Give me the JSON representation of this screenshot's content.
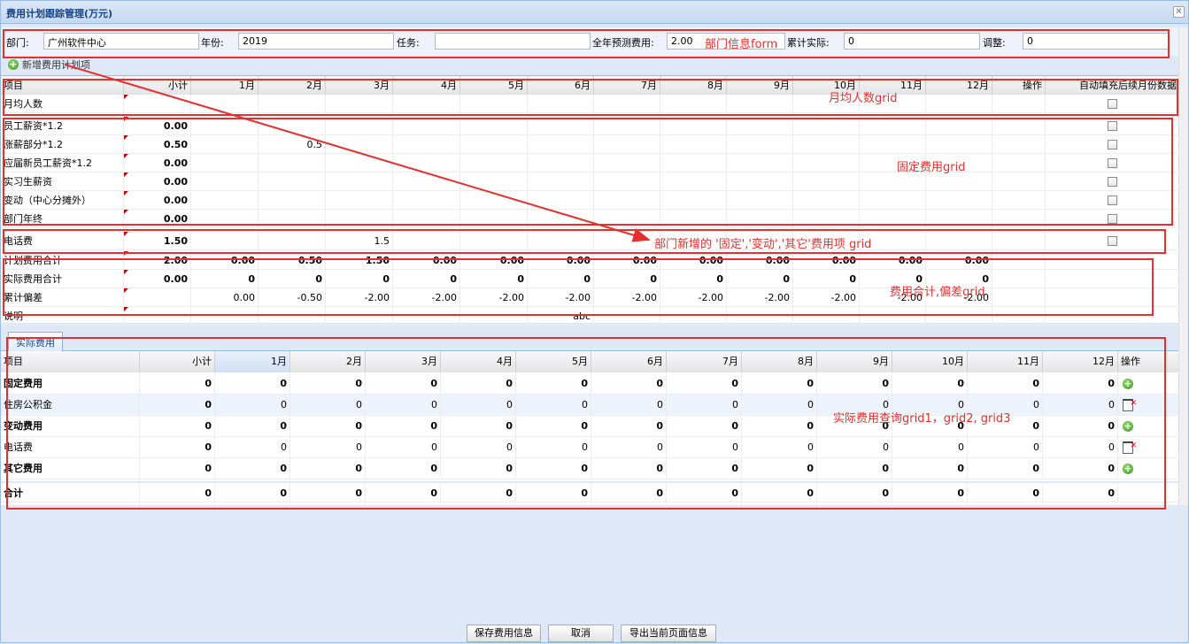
{
  "window": {
    "title": "费用计划跟踪管理(万元)",
    "close_icon": "close-icon"
  },
  "form": {
    "dept_label": "部门:",
    "dept_value": "广州软件中心",
    "year_label": "年份:",
    "year_value": "2019",
    "task_label": "任务:",
    "task_value": "",
    "forecast_label": "全年预测费用:",
    "forecast_value": "2.00",
    "actual_label": "累计实际:",
    "actual_value": "0",
    "adjust_label": "调整:",
    "adjust_value": "0"
  },
  "add_item_label": "新增费用计划项",
  "grid1": {
    "columns": [
      "项目",
      "小计",
      "1月",
      "2月",
      "3月",
      "4月",
      "5月",
      "6月",
      "7月",
      "8月",
      "9月",
      "10月",
      "11月",
      "12月",
      "操作",
      "自动填充后续月份数据"
    ],
    "rows": [
      {
        "name": "月均人数",
        "subtotal": "",
        "months": [
          "",
          "",
          "",
          "",
          "",
          "",
          "",
          "",
          "",
          "",
          "",
          ""
        ],
        "check": true
      },
      {
        "name": "员工薪资*1.2",
        "subtotal": "0.00",
        "months": [
          "",
          "",
          "",
          "",
          "",
          "",
          "",
          "",
          "",
          "",
          "",
          ""
        ],
        "check": true
      },
      {
        "name": "涨薪部分*1.2",
        "subtotal": "0.50",
        "months": [
          "",
          "0.5",
          "",
          "",
          "",
          "",
          "",
          "",
          "",
          "",
          "",
          ""
        ],
        "check": true
      },
      {
        "name": "应届新员工薪资*1.2",
        "subtotal": "0.00",
        "months": [
          "",
          "",
          "",
          "",
          "",
          "",
          "",
          "",
          "",
          "",
          "",
          ""
        ],
        "check": true
      },
      {
        "name": "实习生薪资",
        "subtotal": "0.00",
        "months": [
          "",
          "",
          "",
          "",
          "",
          "",
          "",
          "",
          "",
          "",
          "",
          ""
        ],
        "check": true
      },
      {
        "name": "变动（中心分摊外）",
        "subtotal": "0.00",
        "months": [
          "",
          "",
          "",
          "",
          "",
          "",
          "",
          "",
          "",
          "",
          "",
          ""
        ],
        "check": true
      },
      {
        "name": "部门年终",
        "subtotal": "0.00",
        "months": [
          "",
          "",
          "",
          "",
          "",
          "",
          "",
          "",
          "",
          "",
          "",
          ""
        ],
        "check": true
      },
      {
        "name": "电话费",
        "subtotal": "1.50",
        "months": [
          "",
          "",
          "1.5",
          "",
          "",
          "",
          "",
          "",
          "",
          "",
          "",
          ""
        ],
        "check": true
      },
      {
        "name": "计划费用合计",
        "subtotal": "2.00",
        "months": [
          "0.00",
          "0.50",
          "1.50",
          "0.00",
          "0.00",
          "0.00",
          "0.00",
          "0.00",
          "0.00",
          "0.00",
          "0.00",
          "0.00"
        ],
        "check": false
      },
      {
        "name": "实际费用合计",
        "subtotal": "0.00",
        "months": [
          "0",
          "0",
          "0",
          "0",
          "0",
          "0",
          "0",
          "0",
          "0",
          "0",
          "0",
          "0"
        ],
        "check": false
      },
      {
        "name": "累计偏差",
        "subtotal": "",
        "months": [
          "0.00",
          "-0.50",
          "-2.00",
          "-2.00",
          "-2.00",
          "-2.00",
          "-2.00",
          "-2.00",
          "-2.00",
          "-2.00",
          "-2.00",
          "-2.00"
        ],
        "check": false
      },
      {
        "name": "说明",
        "subtotal": "",
        "months": [
          "",
          "",
          "",
          "",
          "",
          "abc",
          "",
          "",
          "",
          "",
          "",
          ""
        ],
        "check": false
      }
    ]
  },
  "tab_label": "实际费用",
  "grid2": {
    "columns": [
      "项目",
      "小计",
      "1月",
      "2月",
      "3月",
      "4月",
      "5月",
      "6月",
      "7月",
      "8月",
      "9月",
      "10月",
      "11月",
      "12月",
      "操作"
    ],
    "rows": [
      {
        "name": "固定费用",
        "bold": true,
        "vals": [
          "0",
          "0",
          "0",
          "0",
          "0",
          "0",
          "0",
          "0",
          "0",
          "0",
          "0",
          "0",
          "0"
        ],
        "op": "add"
      },
      {
        "name": "住房公积金",
        "bold": false,
        "vals": [
          "0",
          "0",
          "0",
          "0",
          "0",
          "0",
          "0",
          "0",
          "0",
          "0",
          "0",
          "0",
          "0"
        ],
        "op": "delete"
      },
      {
        "name": "变动费用",
        "bold": true,
        "vals": [
          "0",
          "0",
          "0",
          "0",
          "0",
          "0",
          "0",
          "0",
          "0",
          "0",
          "0",
          "0",
          "0"
        ],
        "op": "add"
      },
      {
        "name": "电话费",
        "bold": false,
        "vals": [
          "0",
          "0",
          "0",
          "0",
          "0",
          "0",
          "0",
          "0",
          "0",
          "0",
          "0",
          "0",
          "0"
        ],
        "op": "delete"
      },
      {
        "name": "其它费用",
        "bold": true,
        "vals": [
          "0",
          "0",
          "0",
          "0",
          "0",
          "0",
          "0",
          "0",
          "0",
          "0",
          "0",
          "0",
          "0"
        ],
        "op": "add"
      },
      {
        "name": "合计",
        "bold": true,
        "vals": [
          "0",
          "0",
          "0",
          "0",
          "0",
          "0",
          "0",
          "0",
          "0",
          "0",
          "0",
          "0",
          "0"
        ],
        "op": ""
      }
    ]
  },
  "footer": {
    "save": "保存费用信息",
    "cancel": "取消",
    "export": "导出当前页面信息"
  },
  "annotations": {
    "form": "部门信息form",
    "avg": "月均人数grid",
    "fixed": "固定费用grid",
    "added": "部门新增的 '固定','变动','其它'费用项 grid",
    "total": "费用合计,偏差grid",
    "actual": "实际费用查询grid1，grid2, grid3"
  },
  "colors": {
    "annotation": "#e53030",
    "header_text": "#15428b"
  }
}
